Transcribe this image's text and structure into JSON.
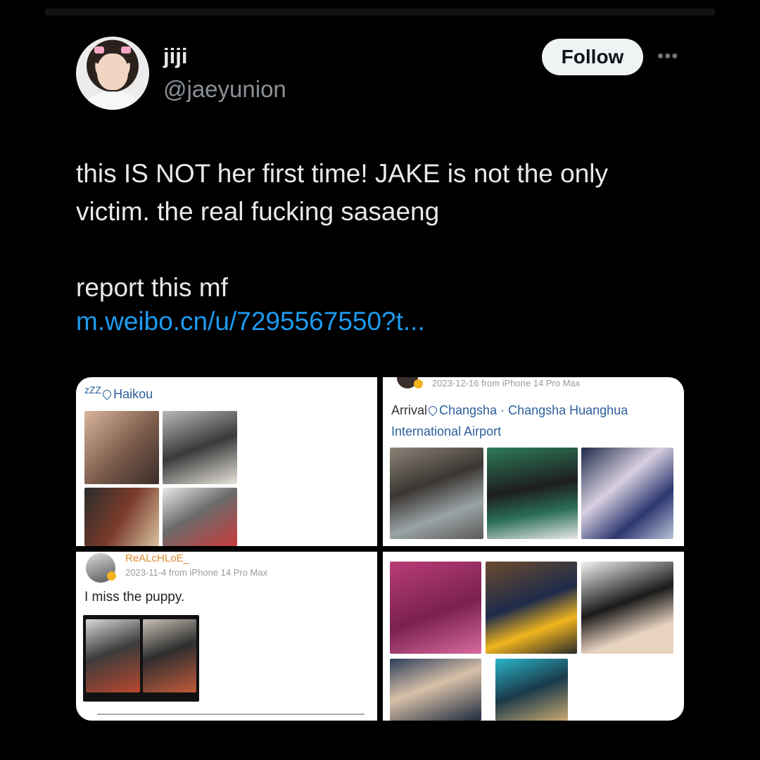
{
  "tweet": {
    "display_name": "jiji",
    "handle": "@jaeyunion",
    "follow_label": "Follow",
    "more_icon": "more-horizontal-icon",
    "text_lines": [
      "this IS NOT her first time! JAKE is not the only",
      "victim. the real fucking sasaeng",
      "",
      "report this mf"
    ],
    "link": "m.weibo.cn/u/7295567550?t..."
  },
  "media": {
    "cell1": {
      "sleep": "zZZ",
      "location": "Haikou"
    },
    "cell2": {
      "meta": "2023-12-16 from iPhone 14 Pro Max",
      "arrival_label": "Arrival",
      "arrival_place": "Changsha · Changsha Huanghua International Airport"
    },
    "cell3": {
      "name": "ReALcHLoE_",
      "meta": "2023-11-4 from iPhone 14 Pro Max",
      "text": "I miss the puppy."
    }
  },
  "colors": {
    "background": "#000000",
    "link": "#1d9bf0",
    "follow_bg": "#eff3f4",
    "weibo_blue": "#2c5f9e"
  }
}
